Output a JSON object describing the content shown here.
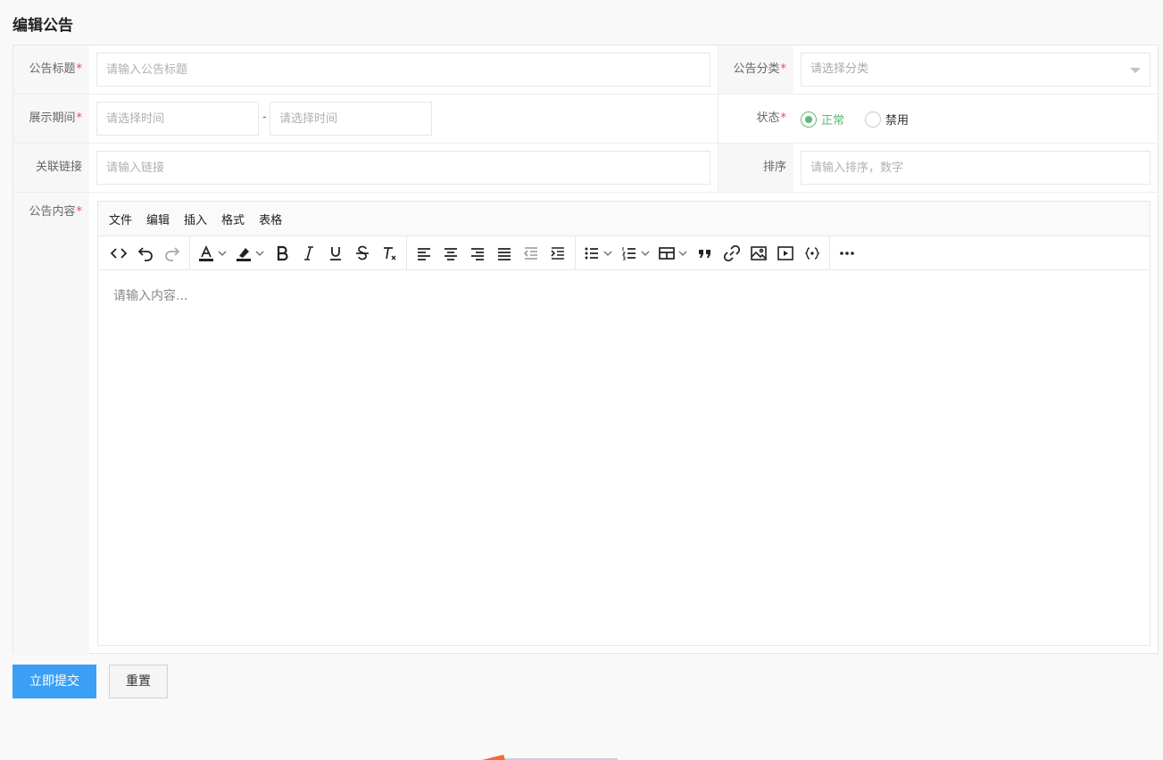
{
  "page_title": "编辑公告",
  "form": {
    "title_label": "公告标题",
    "title_placeholder": "请输入公告标题",
    "category_label": "公告分类",
    "category_placeholder": "请选择分类",
    "period_label": "展示期间",
    "period_start_placeholder": "请选择时间",
    "period_separator": "-",
    "period_end_placeholder": "请选择时间",
    "status_label": "状态",
    "status_options": [
      "正常",
      "禁用"
    ],
    "status_selected": "正常",
    "link_label": "关联链接",
    "link_placeholder": "请输入链接",
    "sort_label": "排序",
    "sort_placeholder": "请输入排序，数字",
    "content_label": "公告内容",
    "required_mark": "*"
  },
  "editor": {
    "menus": [
      "文件",
      "编辑",
      "插入",
      "格式",
      "表格"
    ],
    "placeholder": "请输入内容...",
    "toolbar_icons": [
      "code-icon",
      "undo-icon",
      "redo-icon",
      "text-color-icon",
      "highlight-icon",
      "bold-icon",
      "italic-icon",
      "underline-icon",
      "strikethrough-icon",
      "clear-format-icon",
      "align-left-icon",
      "align-center-icon",
      "align-right-icon",
      "align-justify-icon",
      "outdent-icon",
      "indent-icon",
      "bullet-list-icon",
      "numbered-list-icon",
      "table-icon",
      "blockquote-icon",
      "link-icon",
      "image-icon",
      "media-icon",
      "template-icon",
      "more-icon"
    ]
  },
  "buttons": {
    "submit": "立即提交",
    "reset": "重置"
  },
  "colors": {
    "primary": "#3ba0f5",
    "status_active": "#5fb878",
    "required": "#e84a4a"
  }
}
